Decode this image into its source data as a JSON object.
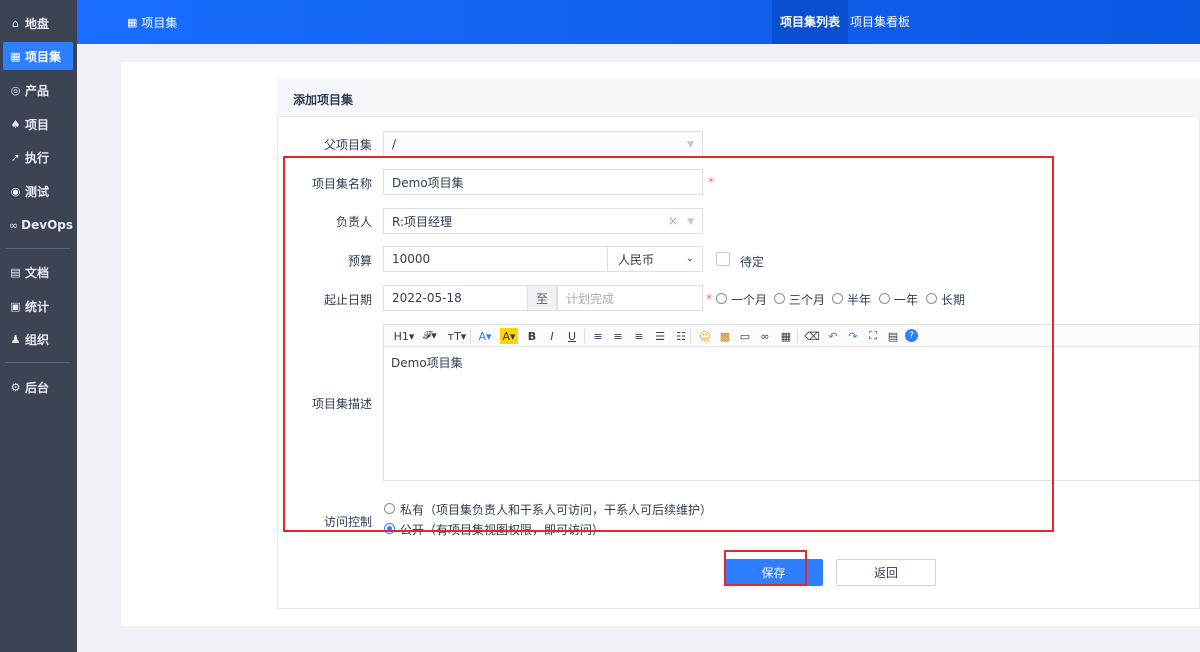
{
  "sidebar": {
    "items": [
      {
        "label": "地盘",
        "icon": "home-icon",
        "glyph": "⌂"
      },
      {
        "label": "项目集",
        "icon": "grid-icon",
        "glyph": "▦"
      },
      {
        "label": "产品",
        "icon": "product-icon",
        "glyph": "◎"
      },
      {
        "label": "项目",
        "icon": "project-icon",
        "glyph": "♠"
      },
      {
        "label": "执行",
        "icon": "run-icon",
        "glyph": "➚"
      },
      {
        "label": "测试",
        "icon": "test-icon",
        "glyph": "◉"
      },
      {
        "label": "DevOps",
        "icon": "infinity-icon",
        "glyph": "∞"
      },
      {
        "label": "文档",
        "icon": "doc-icon",
        "glyph": "▤"
      },
      {
        "label": "统计",
        "icon": "stats-icon",
        "glyph": "▣"
      },
      {
        "label": "组织",
        "icon": "people-icon",
        "glyph": "♟"
      },
      {
        "label": "后台",
        "icon": "gear-icon",
        "glyph": "⚙"
      }
    ],
    "active_index": 1
  },
  "topbar": {
    "breadcrumb": "项目集",
    "breadcrumb_glyph": "▦",
    "tabs": [
      "项目集列表",
      "项目集看板"
    ],
    "active_tab": 0
  },
  "form": {
    "title": "添加项目集",
    "parent": {
      "label": "父项目集",
      "value": "/"
    },
    "name": {
      "label": "项目集名称",
      "value": "Demo项目集",
      "required": "*"
    },
    "owner": {
      "label": "负责人",
      "value": "R:项目经理",
      "clear": "×"
    },
    "budget": {
      "label": "预算",
      "value": "10000",
      "currency": "人民币",
      "pending_label": "待定"
    },
    "dates": {
      "label": "起止日期",
      "start": "2022-05-18",
      "separator": "至",
      "end_placeholder": "计划完成",
      "required": "*",
      "quick_options": [
        "一个月",
        "三个月",
        "半年",
        "一年",
        "长期"
      ]
    },
    "description": {
      "label": "项目集描述",
      "value": "Demo项目集"
    },
    "access": {
      "label": "访问控制",
      "options": [
        {
          "text": "私有（项目集负责人和干系人可访问，干系人可后续维护）",
          "checked": false
        },
        {
          "text": "公开（有项目集视图权限，即可访问）",
          "checked": true
        }
      ]
    },
    "buttons": {
      "save": "保存",
      "back": "返回"
    }
  },
  "editor_toolbar": [
    {
      "glyph": "H1▾",
      "name": "heading-icon"
    },
    {
      "glyph": "𝓕▾",
      "name": "font-family-icon"
    },
    {
      "glyph": "тT▾",
      "name": "font-size-icon"
    },
    {
      "glyph": "A▾",
      "name": "font-color-icon"
    },
    {
      "glyph": "A▾",
      "name": "highlight-icon"
    },
    {
      "glyph": "B",
      "name": "bold-icon"
    },
    {
      "glyph": "I",
      "name": "italic-icon"
    },
    {
      "glyph": "U",
      "name": "underline-icon"
    },
    {
      "glyph": "≡",
      "name": "align-left-icon"
    },
    {
      "glyph": "≡",
      "name": "align-center-icon"
    },
    {
      "glyph": "≡",
      "name": "align-right-icon"
    },
    {
      "glyph": "☰",
      "name": "ordered-list-icon"
    },
    {
      "glyph": "☷",
      "name": "unordered-list-icon"
    },
    {
      "glyph": "☺",
      "name": "emoticon-icon"
    },
    {
      "glyph": "▩",
      "name": "image-icon"
    },
    {
      "glyph": "▭",
      "name": "code-icon"
    },
    {
      "glyph": "∞",
      "name": "link-icon"
    },
    {
      "glyph": "▦",
      "name": "table-icon"
    },
    {
      "glyph": "⌫",
      "name": "eraser-icon"
    },
    {
      "glyph": "↶",
      "name": "undo-icon"
    },
    {
      "glyph": "↷",
      "name": "redo-icon"
    },
    {
      "glyph": "⛶",
      "name": "fullscreen-icon"
    },
    {
      "glyph": "▤",
      "name": "source-icon"
    },
    {
      "glyph": "?",
      "name": "help-icon"
    }
  ],
  "colors": {
    "primary": "#2e7fff",
    "sidebar": "#3c4353",
    "highlight": "#e0282e",
    "required": "#f56c6c"
  }
}
